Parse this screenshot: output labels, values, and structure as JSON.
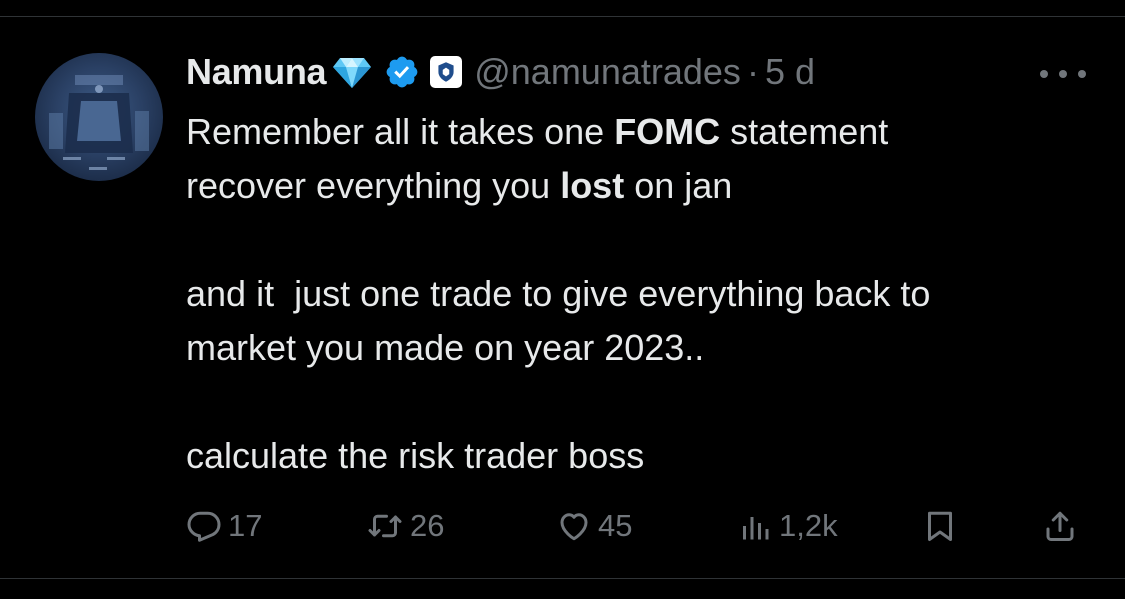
{
  "tweet": {
    "author": {
      "display_name": "Namuna",
      "name_emoji_icon": "gem-stone-icon",
      "handle": "@namunatrades",
      "separator": "·",
      "time": "5 d"
    },
    "text": {
      "line1_pre": "Remember all it takes one ",
      "line1_bold": "FOMC",
      "line1_post": " statement",
      "line2_pre": "recover everything you ",
      "line2_bold": "lost",
      "line2_post": " on jan",
      "line3": "and it  just one trade to give everything back to",
      "line4": "market you made on year 2023..",
      "line5": "calculate the risk trader boss"
    },
    "actions": {
      "replies": "17",
      "reposts": "26",
      "likes": "45",
      "views": "1,2k"
    }
  },
  "colors": {
    "background": "#000000",
    "text_primary": "#e7e9ea",
    "text_secondary": "#71767b",
    "verified_blue": "#1d9bf0",
    "divider": "#2f3336"
  }
}
